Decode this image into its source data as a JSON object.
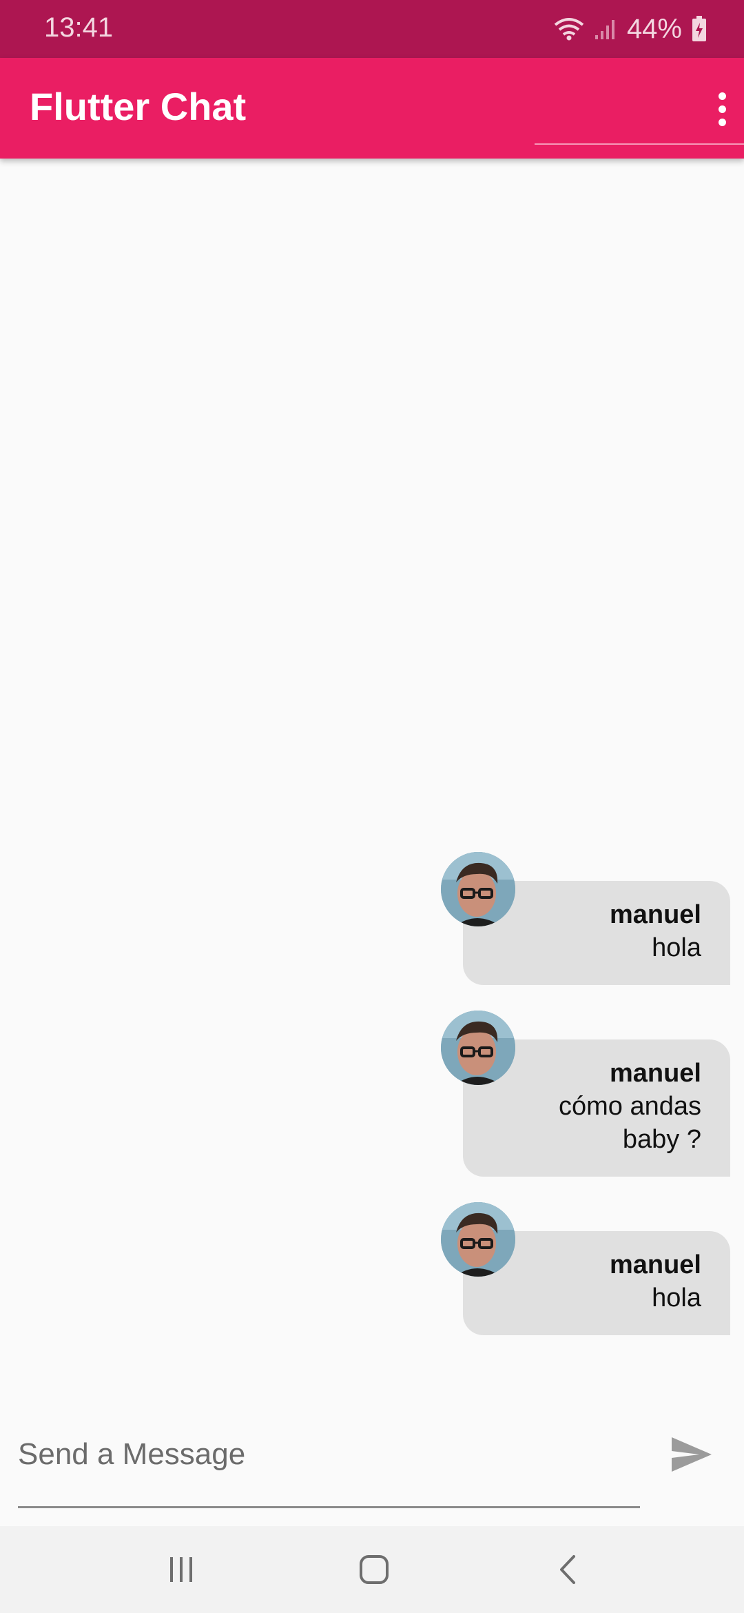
{
  "status_bar": {
    "time": "13:41",
    "battery": "44%"
  },
  "app_bar": {
    "title": "Flutter Chat"
  },
  "messages": [
    {
      "user": "manuel",
      "text": "hola"
    },
    {
      "user": "manuel",
      "text": "cómo andas baby ?"
    },
    {
      "user": "manuel",
      "text": "hola"
    }
  ],
  "composer": {
    "placeholder": "Send a Message",
    "value": ""
  },
  "colors": {
    "status_bar": "#ad1651",
    "app_bar": "#ea1e63",
    "bubble": "#e0e0e0",
    "background": "#fafafa"
  },
  "icons": {
    "menu": "more-vert-icon",
    "send": "send-icon",
    "nav_recents": "recents-icon",
    "nav_home": "home-icon",
    "nav_back": "back-icon"
  }
}
